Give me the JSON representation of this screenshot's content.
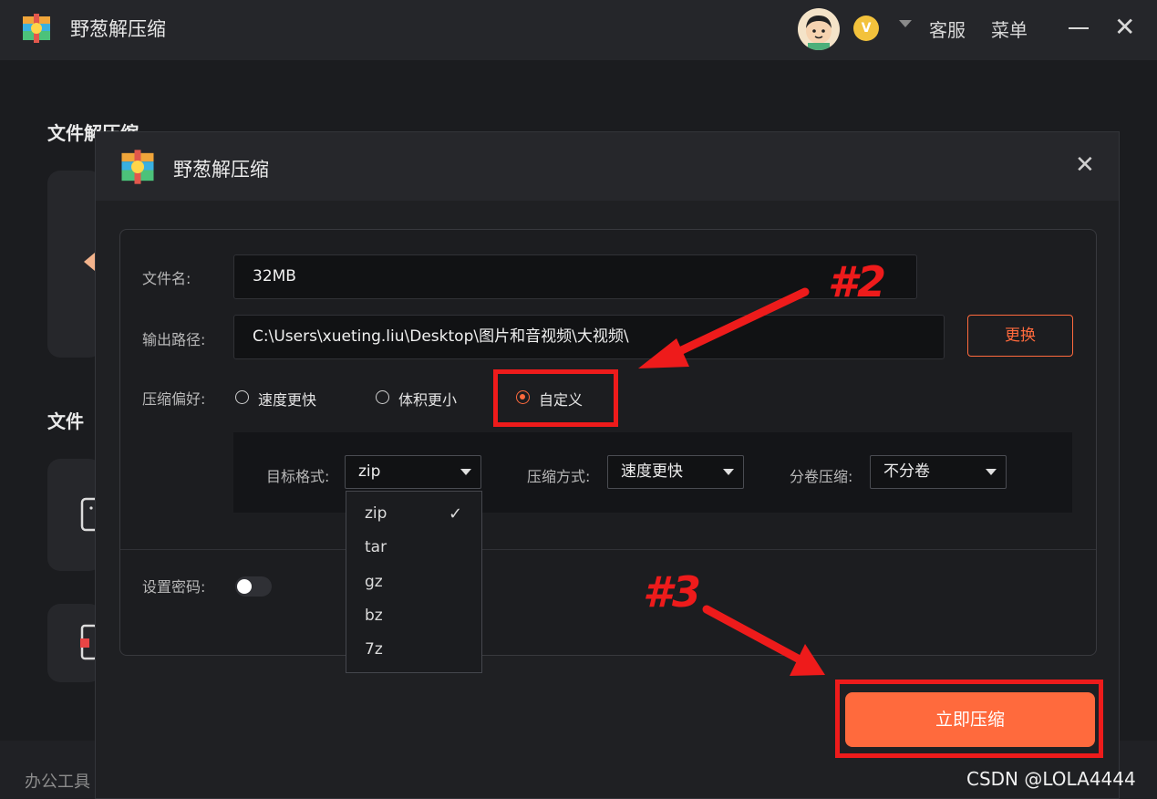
{
  "app": {
    "title": "野葱解压缩",
    "nav": {
      "service_label": "客服",
      "menu_label": "菜单"
    },
    "vip_badge": "V"
  },
  "background": {
    "section1_title": "文件解压缩",
    "section2_title": "文件",
    "footer_text": "办公工具"
  },
  "dialog": {
    "title": "野葱解压缩",
    "filename": {
      "label": "文件名:",
      "value": "32MB"
    },
    "output_path": {
      "label": "输出路径:",
      "value": "C:\\Users\\xueting.liu\\Desktop\\图片和音视频\\大视频\\",
      "change_label": "更换"
    },
    "preference": {
      "label": "压缩偏好:",
      "options": [
        {
          "label": "速度更快",
          "selected": false
        },
        {
          "label": "体积更小",
          "selected": false
        },
        {
          "label": "自定义",
          "selected": true
        }
      ]
    },
    "advanced": {
      "format": {
        "label": "目标格式:",
        "value": "zip"
      },
      "method": {
        "label": "压缩方式:",
        "value": "速度更快"
      },
      "split": {
        "label": "分卷压缩:",
        "value": "不分卷"
      }
    },
    "format_options": [
      "zip",
      "tar",
      "gz",
      "bz",
      "7z"
    ],
    "format_selected": "zip",
    "password": {
      "label": "设置密码:",
      "enabled": false
    },
    "submit_label": "立即压缩"
  },
  "annotations": {
    "step2": "#2",
    "step3": "#3",
    "color": "#ee1b1b"
  },
  "watermark": "CSDN @LOLA4444",
  "colors": {
    "accent": "#ff6a3d",
    "bg": "#1b1c1f",
    "annotation": "#ee1b1b"
  }
}
